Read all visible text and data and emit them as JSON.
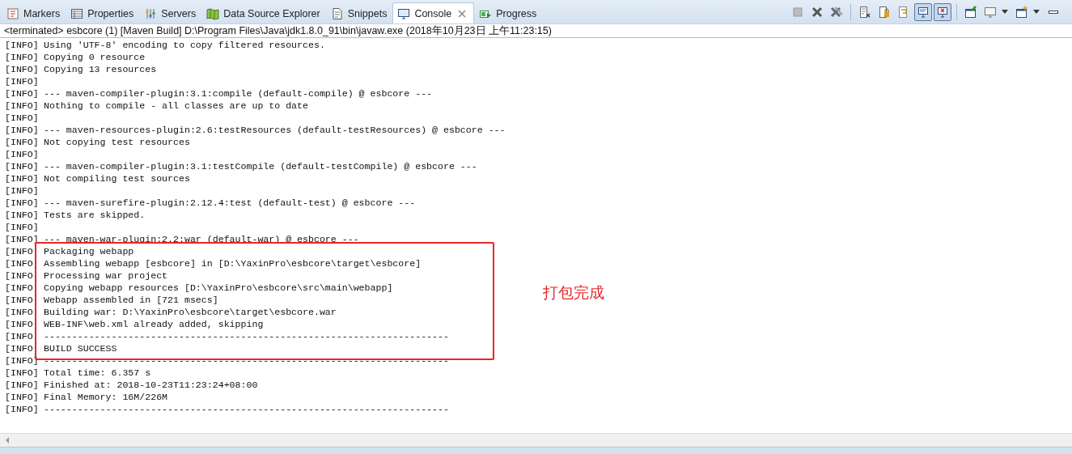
{
  "tabs": [
    {
      "label": "Markers",
      "kind": "markers",
      "selected": false,
      "closable": false
    },
    {
      "label": "Properties",
      "kind": "properties",
      "selected": false,
      "closable": false
    },
    {
      "label": "Servers",
      "kind": "servers",
      "selected": false,
      "closable": false
    },
    {
      "label": "Data Source Explorer",
      "kind": "datasource",
      "selected": false,
      "closable": false
    },
    {
      "label": "Snippets",
      "kind": "snippets",
      "selected": false,
      "closable": false
    },
    {
      "label": "Console",
      "kind": "console",
      "selected": true,
      "closable": true
    },
    {
      "label": "Progress",
      "kind": "progress",
      "selected": false,
      "closable": false
    }
  ],
  "toolbar": [
    {
      "kind": "stop",
      "pressed": false,
      "dropdown": false,
      "separator_after": false
    },
    {
      "kind": "remove",
      "pressed": false,
      "dropdown": false,
      "separator_after": false
    },
    {
      "kind": "remove-all",
      "pressed": false,
      "dropdown": false,
      "separator_after": true
    },
    {
      "kind": "clear",
      "pressed": false,
      "dropdown": false,
      "separator_after": false
    },
    {
      "kind": "scroll-lock",
      "pressed": false,
      "dropdown": false,
      "separator_after": false
    },
    {
      "kind": "word-wrap",
      "pressed": false,
      "dropdown": false,
      "separator_after": false
    },
    {
      "kind": "stdout",
      "pressed": true,
      "dropdown": false,
      "separator_after": false
    },
    {
      "kind": "stderr",
      "pressed": true,
      "dropdown": false,
      "separator_after": true
    },
    {
      "kind": "pin",
      "pressed": false,
      "dropdown": false,
      "separator_after": false
    },
    {
      "kind": "display",
      "pressed": false,
      "dropdown": true,
      "separator_after": false
    },
    {
      "kind": "open",
      "pressed": false,
      "dropdown": true,
      "separator_after": false
    },
    {
      "kind": "minimize",
      "pressed": false,
      "dropdown": false,
      "separator_after": false
    }
  ],
  "console": {
    "header": "<terminated> esbcore (1) [Maven Build] D:\\Program Files\\Java\\jdk1.8.0_91\\bin\\javaw.exe (2018年10月23日 上午11:23:15)",
    "lines_before": [
      {
        "prefix": "[INFO]",
        "text": "Using 'UTF-8' encoding to copy filtered resources."
      },
      {
        "prefix": "[INFO]",
        "text": "Copying 0 resource"
      },
      {
        "prefix": "[INFO]",
        "text": "Copying 13 resources"
      },
      {
        "prefix": "[INFO]"
      },
      {
        "prefix": "[INFO]",
        "text": "--- maven-compiler-plugin:3.1:compile (default-compile) @ esbcore ---"
      },
      {
        "prefix": "[INFO]",
        "text": "Nothing to compile - all classes are up to date"
      },
      {
        "prefix": "[INFO]"
      },
      {
        "prefix": "[INFO]",
        "text": "--- maven-resources-plugin:2.6:testResources (default-testResources) @ esbcore ---"
      },
      {
        "prefix": "[INFO]",
        "text": "Not copying test resources"
      },
      {
        "prefix": "[INFO]"
      },
      {
        "prefix": "[INFO]",
        "text": "--- maven-compiler-plugin:3.1:testCompile (default-testCompile) @ esbcore ---"
      },
      {
        "prefix": "[INFO]",
        "text": "Not compiling test sources"
      },
      {
        "prefix": "[INFO]"
      },
      {
        "prefix": "[INFO]",
        "text": "--- maven-surefire-plugin:2.12.4:test (default-test) @ esbcore ---"
      },
      {
        "prefix": "[INFO]",
        "text": "Tests are skipped."
      },
      {
        "prefix": "[INFO]"
      },
      {
        "prefix": "[INFO]",
        "text": "--- maven-war-plugin:2.2:war (default-war) @ esbcore ---"
      }
    ],
    "highlight": {
      "lines": [
        {
          "prefix": "[INFO",
          "text": "Packaging webapp"
        },
        {
          "prefix": "[INFO",
          "text": "Assembling webapp [esbcore] in [D:\\YaxinPro\\esbcore\\target\\esbcore]"
        },
        {
          "prefix": "[INFO",
          "text": "Processing war project"
        },
        {
          "prefix": "[INFO",
          "text": "Copying webapp resources [D:\\YaxinPro\\esbcore\\src\\main\\webapp]"
        },
        {
          "prefix": "[INFO",
          "text": "Webapp assembled in [721 msecs]"
        },
        {
          "prefix": "[INFO",
          "text": "Building war: D:\\YaxinPro\\esbcore\\target\\esbcore.war"
        },
        {
          "prefix": "[INFO",
          "text": "WEB-INF\\web.xml already added, skipping"
        },
        {
          "prefix": "[INFO",
          "text": "------------------------------------------------------------------------"
        },
        {
          "prefix": "[INFO",
          "text": "BUILD SUCCESS"
        }
      ],
      "note": "打包完成"
    },
    "lines_after": [
      {
        "prefix": "[INFO]",
        "text": "------------------------------------------------------------------------"
      },
      {
        "prefix": "[INFO]",
        "text": "Total time: 6.357 s"
      },
      {
        "prefix": "[INFO]",
        "text": "Finished at: 2018-10-23T11:23:24+08:00"
      },
      {
        "prefix": "[INFO]",
        "text": "Final Memory: 16M/226M"
      },
      {
        "prefix": "[INFO]",
        "text": "------------------------------------------------------------------------"
      }
    ]
  }
}
